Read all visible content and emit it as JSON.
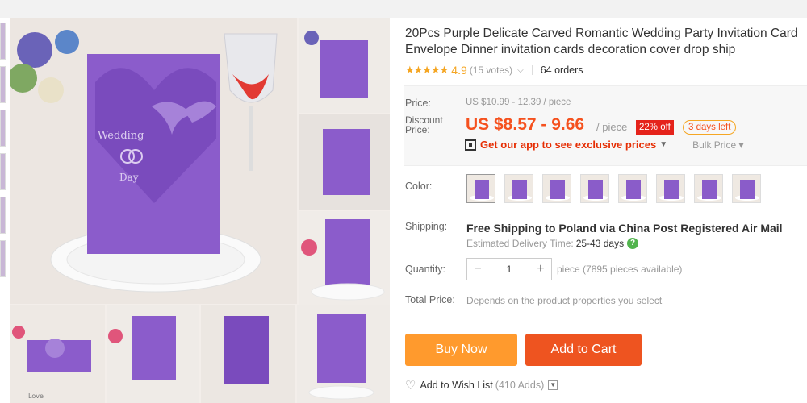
{
  "product": {
    "title": "20Pcs Purple Delicate Carved Romantic Wedding Party Invitation Card Envelope Dinner invitation cards decoration cover drop ship",
    "stars": "★★★★★",
    "rating": "4.9",
    "votes": "(15 votes)",
    "orders": "64 orders"
  },
  "price": {
    "label": "Price:",
    "original": "US $10.99 - 12.39 / piece",
    "discount_label": "Discount Price:",
    "discount": "US $8.57 - 9.66",
    "unit": "/ piece",
    "off_badge": "22% off",
    "days_left": "3 days left",
    "app_promo": "Get our app to see exclusive prices",
    "bulk": "Bulk Price"
  },
  "color": {
    "label": "Color:",
    "swatch_count": 8
  },
  "shipping": {
    "label": "Shipping:",
    "title": "Free Shipping to Poland via China Post Registered Air Mail",
    "est_label": "Estimated Delivery Time:",
    "est_value": "25-43 days"
  },
  "quantity": {
    "label": "Quantity:",
    "minus": "−",
    "value": "1",
    "plus": "+",
    "available": "piece (7895 pieces available)"
  },
  "total": {
    "label": "Total Price:",
    "note": "Depends on the product properties you select"
  },
  "actions": {
    "buy_now": "Buy Now",
    "add_to_cart": "Add to Cart",
    "wishlist": "Add to Wish List",
    "wishlist_count": "(410 Adds)"
  },
  "image_text": {
    "main_line1": "Wedding",
    "main_line2": "Day",
    "thumb_line": "Love"
  },
  "colors": {
    "accent_orange": "#ff9a2d",
    "accent_red": "#ee5420",
    "price_red": "#f5511e",
    "purple": "#8a5cc9"
  }
}
